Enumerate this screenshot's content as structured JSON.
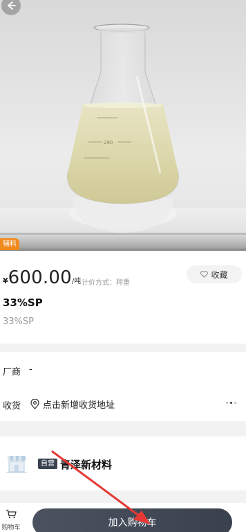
{
  "product": {
    "category_tag": "辅料",
    "currency": "¥",
    "price": "600.00",
    "unit": "/吨",
    "pricing_method": "计价方式：称重",
    "favorite_label": "收藏",
    "title": "33%SP",
    "subtitle": "33%SP"
  },
  "info": {
    "manufacturer_label": "厂商",
    "manufacturer_value": "-",
    "shipping_label": "收货",
    "shipping_value": "点击新增收货地址"
  },
  "shop": {
    "badge": "自营",
    "name": "青泽新材料"
  },
  "bottom_bar": {
    "cart_label": "购物车",
    "add_to_cart_label": "加入购物车"
  },
  "colors": {
    "accent_orange": "#f08a1c",
    "button_dark": "#3a414e",
    "annotation_red": "#e53935"
  },
  "icons": [
    "back-arrow-icon",
    "heart-icon",
    "location-pin-icon",
    "shop-icon",
    "cart-icon",
    "red-arrow-annotation"
  ]
}
